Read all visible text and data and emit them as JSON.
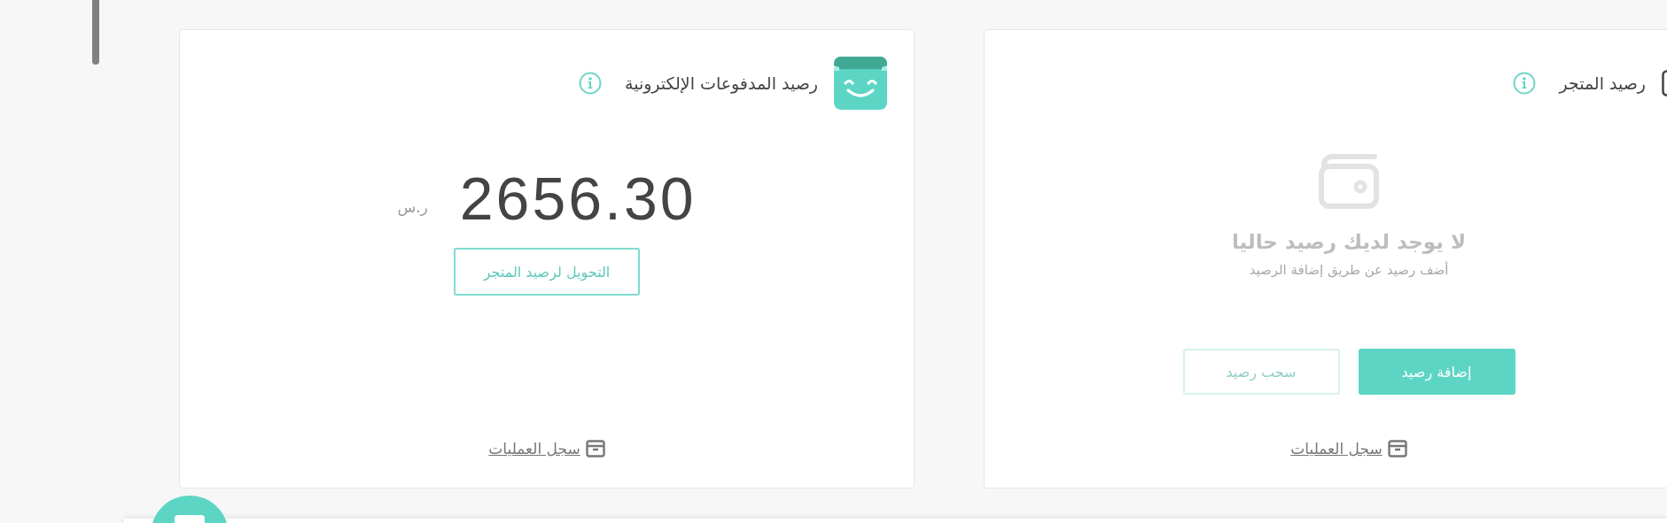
{
  "cards": [
    {
      "kind": "empty",
      "title": "رصيد المتجر",
      "empty_title": "لا يوجد لديك رصيد حاليا",
      "empty_subtitle": "أضف رصيد عن طريق إضافة الرصيد",
      "buttons": [
        {
          "label": "إضافة رصيد",
          "kind": "primary",
          "disabled": false
        },
        {
          "label": "سحب رصيد",
          "kind": "outline",
          "disabled": true
        }
      ],
      "log_link": "سجل العمليات"
    },
    {
      "kind": "balance",
      "title": "رصيد المدفوعات الإلكترونية",
      "amount": "2656.30",
      "currency": "ر.س",
      "action": "التحويل لرصيد المتجر",
      "log_link": "سجل العمليات"
    }
  ]
}
